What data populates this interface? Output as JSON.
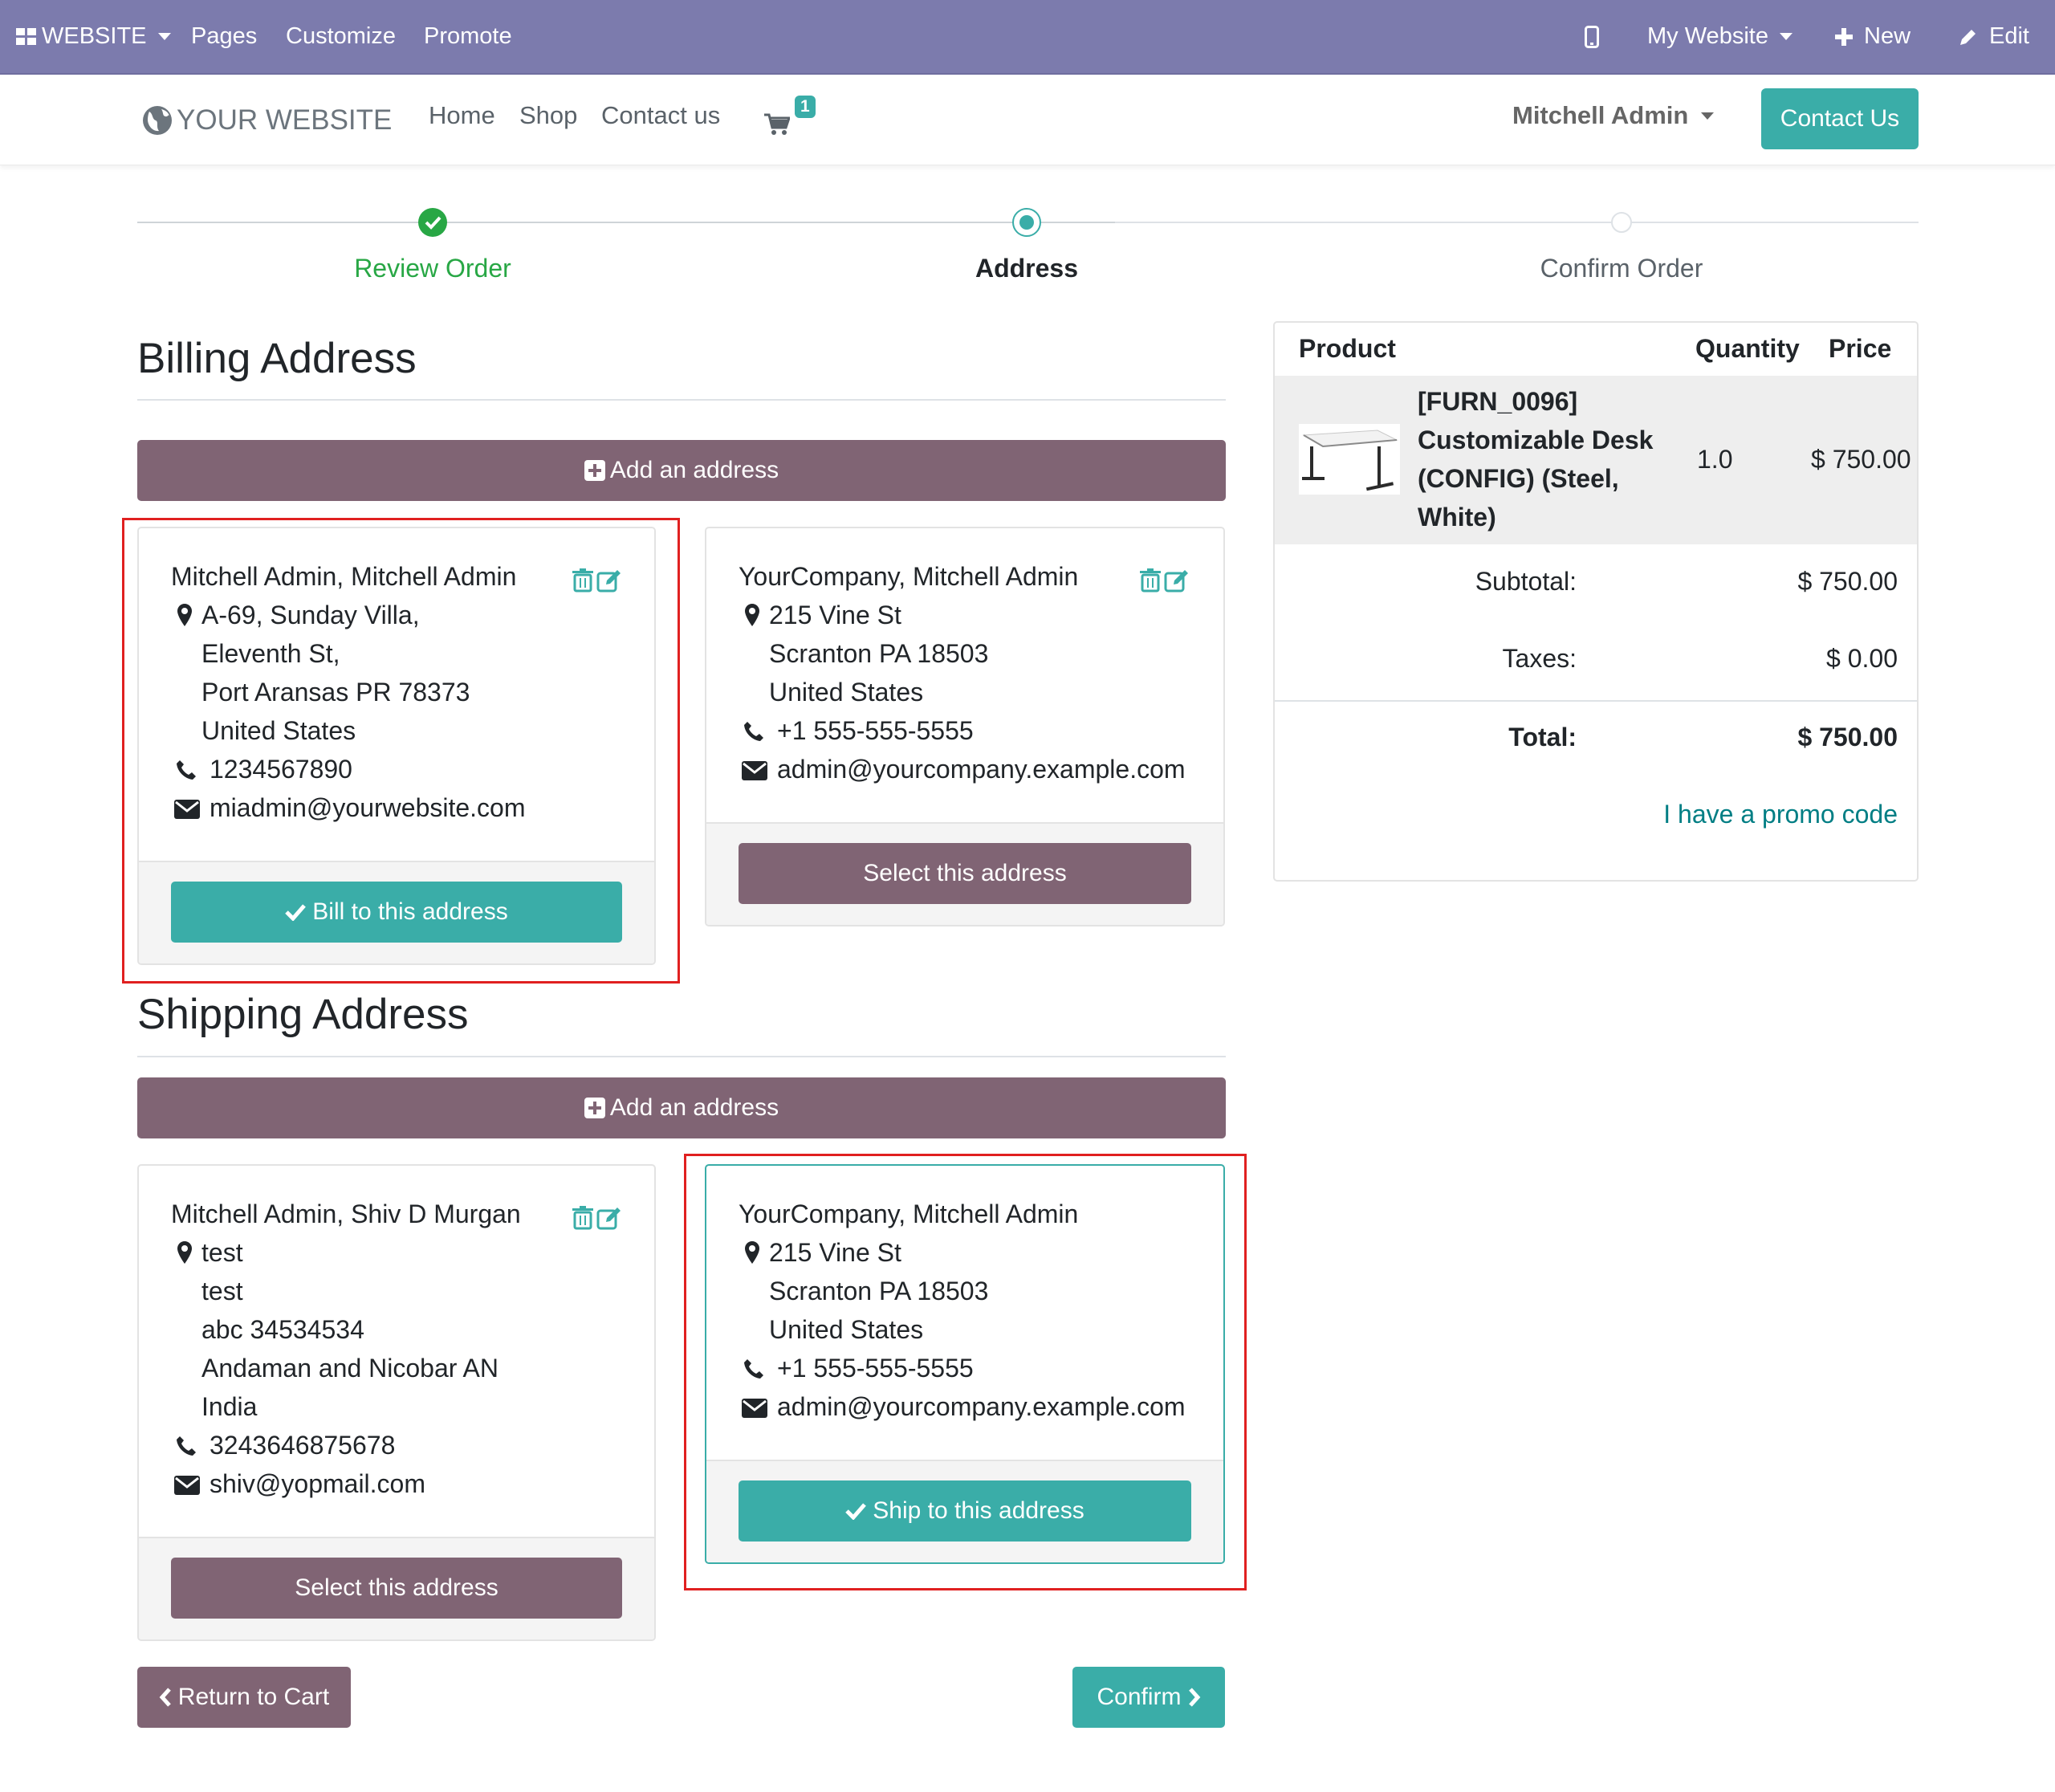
{
  "admin_bar": {
    "app_label": "WEBSITE",
    "menu": [
      "Pages",
      "Customize",
      "Promote"
    ],
    "website_selector": "My Website",
    "new_label": "New",
    "edit_label": "Edit"
  },
  "site_header": {
    "logo_text": "YOUR WEBSITE",
    "nav": [
      "Home",
      "Shop",
      "Contact us"
    ],
    "cart_count": "1",
    "user_name": "Mitchell Admin",
    "contact_button": "Contact Us"
  },
  "wizard": {
    "steps": [
      {
        "label": "Review Order",
        "state": "done"
      },
      {
        "label": "Address",
        "state": "current"
      },
      {
        "label": "Confirm Order",
        "state": "todo"
      }
    ]
  },
  "billing": {
    "title": "Billing Address",
    "add_label": "Add an address",
    "cards": [
      {
        "name": "Mitchell Admin, Mitchell Admin",
        "lines": [
          "A-69, Sunday Villa,",
          "Eleventh St,",
          "Port Aransas PR 78373",
          "United States"
        ],
        "phone": "1234567890",
        "email": "miadmin@yourwebsite.com",
        "button": "Bill to this address",
        "selected": true
      },
      {
        "name": "YourCompany, Mitchell Admin",
        "lines": [
          "215 Vine St",
          "Scranton PA 18503",
          "United States"
        ],
        "phone": "+1 555-555-5555",
        "email": "admin@yourcompany.example.com",
        "button": "Select this address",
        "selected": false
      }
    ]
  },
  "shipping": {
    "title": "Shipping Address",
    "add_label": "Add an address",
    "cards": [
      {
        "name": "Mitchell Admin, Shiv D Murgan",
        "lines": [
          "test",
          "test",
          "abc 34534534",
          "Andaman and Nicobar AN",
          "India"
        ],
        "phone": "3243646875678",
        "email": "shiv@yopmail.com",
        "button": "Select this address",
        "selected": false
      },
      {
        "name": "YourCompany, Mitchell Admin",
        "lines": [
          "215 Vine St",
          "Scranton PA 18503",
          "United States"
        ],
        "phone": "+1 555-555-5555",
        "email": "admin@yourcompany.example.com",
        "button": "Ship to this address",
        "selected": true
      }
    ]
  },
  "order_summary": {
    "headers": {
      "product": "Product",
      "quantity": "Quantity",
      "price": "Price"
    },
    "items": [
      {
        "name_lines": [
          "[FURN_0096]",
          "Customizable Desk",
          "(CONFIG) (Steel,",
          "White)"
        ],
        "quantity": "1.0",
        "price": "$ 750.00"
      }
    ],
    "subtotal_label": "Subtotal:",
    "subtotal": "$ 750.00",
    "taxes_label": "Taxes:",
    "taxes": "$ 0.00",
    "total_label": "Total:",
    "total": "$ 750.00",
    "promo_link": "I have a promo code"
  },
  "footer_buttons": {
    "return": "Return to Cart",
    "confirm": "Confirm"
  },
  "colors": {
    "admin_bar": "#7c7bad",
    "primary_teal": "#3aada8",
    "secondary_mauve": "#806474",
    "success_green": "#28a745",
    "highlight_red": "#e02020"
  }
}
